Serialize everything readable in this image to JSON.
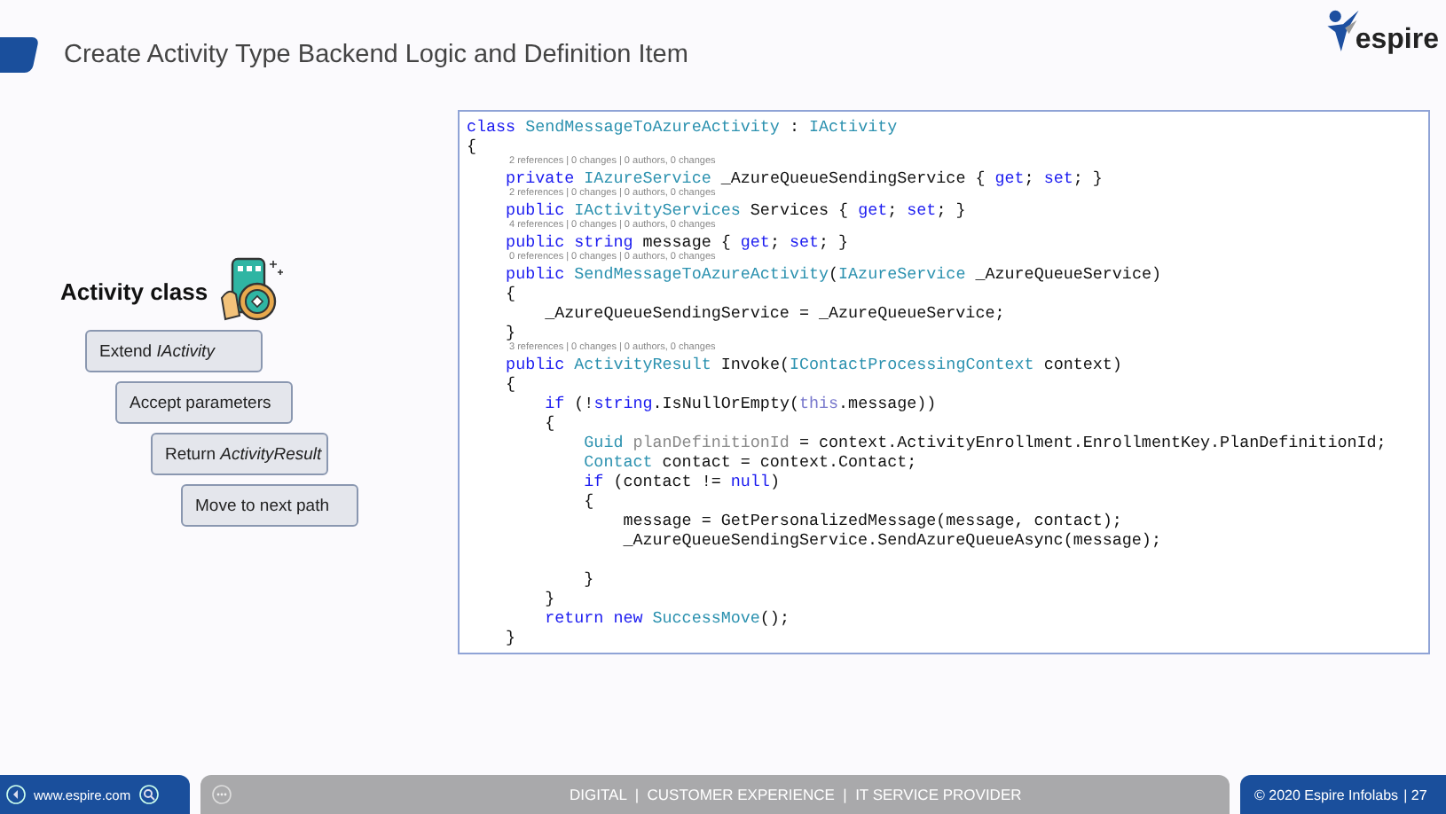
{
  "slide": {
    "title": "Create Activity Type Backend Logic and Definition Item",
    "logo_text": "espire",
    "activity_heading": "Activity class",
    "steps": [
      "Extend *IActivity*",
      "Accept parameters",
      "Return *ActivityResult*",
      "Move to next path"
    ],
    "code_lines": [
      {
        "kind": "code",
        "tokens": [
          {
            "kind": "kw",
            "text": "class "
          },
          {
            "kind": "type",
            "text": "SendMessageToAzureActivity"
          },
          {
            "kind": "plain",
            "text": " : "
          },
          {
            "kind": "type",
            "text": "IActivity"
          }
        ]
      },
      {
        "kind": "code",
        "tokens": [
          {
            "kind": "plain",
            "text": "{"
          }
        ]
      },
      {
        "kind": "lens",
        "tokens": [
          {
            "kind": "plain",
            "text": "2 references | 0 changes | 0 authors, 0 changes"
          }
        ]
      },
      {
        "kind": "code",
        "tokens": [
          {
            "kind": "kw",
            "text": "    private "
          },
          {
            "kind": "type",
            "text": "IAzureService"
          },
          {
            "kind": "plain",
            "text": " _AzureQueueSendingService { "
          },
          {
            "kind": "kw",
            "text": "get"
          },
          {
            "kind": "plain",
            "text": "; "
          },
          {
            "kind": "kw",
            "text": "set"
          },
          {
            "kind": "plain",
            "text": "; }"
          }
        ]
      },
      {
        "kind": "lens",
        "tokens": [
          {
            "kind": "plain",
            "text": "2 references | 0 changes | 0 authors, 0 changes"
          }
        ]
      },
      {
        "kind": "code",
        "tokens": [
          {
            "kind": "kw",
            "text": "    public "
          },
          {
            "kind": "type",
            "text": "IActivityServices"
          },
          {
            "kind": "plain",
            "text": " Services { "
          },
          {
            "kind": "kw",
            "text": "get"
          },
          {
            "kind": "plain",
            "text": "; "
          },
          {
            "kind": "kw",
            "text": "set"
          },
          {
            "kind": "plain",
            "text": "; }"
          }
        ]
      },
      {
        "kind": "lens",
        "tokens": [
          {
            "kind": "plain",
            "text": "4 references | 0 changes | 0 authors, 0 changes"
          }
        ]
      },
      {
        "kind": "code",
        "tokens": [
          {
            "kind": "kw",
            "text": "    public string "
          },
          {
            "kind": "plain",
            "text": "message { "
          },
          {
            "kind": "kw",
            "text": "get"
          },
          {
            "kind": "plain",
            "text": "; "
          },
          {
            "kind": "kw",
            "text": "set"
          },
          {
            "kind": "plain",
            "text": "; }"
          }
        ]
      },
      {
        "kind": "lens",
        "tokens": [
          {
            "kind": "plain",
            "text": "0 references | 0 changes | 0 authors, 0 changes"
          }
        ]
      },
      {
        "kind": "code",
        "tokens": [
          {
            "kind": "kw",
            "text": "    public "
          },
          {
            "kind": "type",
            "text": "SendMessageToAzureActivity"
          },
          {
            "kind": "plain",
            "text": "("
          },
          {
            "kind": "type",
            "text": "IAzureService"
          },
          {
            "kind": "plain",
            "text": " _AzureQueueService)"
          }
        ]
      },
      {
        "kind": "code",
        "tokens": [
          {
            "kind": "plain",
            "text": "    {"
          }
        ]
      },
      {
        "kind": "code",
        "tokens": [
          {
            "kind": "plain",
            "text": "        _AzureQueueSendingService = _AzureQueueService;"
          }
        ]
      },
      {
        "kind": "code",
        "tokens": [
          {
            "kind": "plain",
            "text": "    }"
          }
        ]
      },
      {
        "kind": "lens",
        "tokens": [
          {
            "kind": "plain",
            "text": "3 references | 0 changes | 0 authors, 0 changes"
          }
        ]
      },
      {
        "kind": "code",
        "tokens": [
          {
            "kind": "kw",
            "text": "    public "
          },
          {
            "kind": "type",
            "text": "ActivityResult"
          },
          {
            "kind": "plain",
            "text": " Invoke("
          },
          {
            "kind": "type",
            "text": "IContactProcessingContext"
          },
          {
            "kind": "plain",
            "text": " context)"
          }
        ]
      },
      {
        "kind": "code",
        "tokens": [
          {
            "kind": "plain",
            "text": "    {"
          }
        ]
      },
      {
        "kind": "code",
        "tokens": [
          {
            "kind": "kw",
            "text": "        if"
          },
          {
            "kind": "plain",
            "text": " (!"
          },
          {
            "kind": "kw",
            "text": "string"
          },
          {
            "kind": "plain",
            "text": ".IsNullOrEmpty("
          },
          {
            "kind": "this",
            "text": "this"
          },
          {
            "kind": "plain",
            "text": ".message))"
          }
        ]
      },
      {
        "kind": "code",
        "tokens": [
          {
            "kind": "plain",
            "text": "        {"
          }
        ]
      },
      {
        "kind": "code",
        "tokens": [
          {
            "kind": "type",
            "text": "            Guid"
          },
          {
            "kind": "dim",
            "text": " planDefinitionId"
          },
          {
            "kind": "plain",
            "text": " = context.ActivityEnrollment.EnrollmentKey.PlanDefinitionId;"
          }
        ]
      },
      {
        "kind": "code",
        "tokens": [
          {
            "kind": "type",
            "text": "            Contact"
          },
          {
            "kind": "plain",
            "text": " contact = context.Contact;"
          }
        ]
      },
      {
        "kind": "code",
        "tokens": [
          {
            "kind": "kw",
            "text": "            if"
          },
          {
            "kind": "plain",
            "text": " (contact != "
          },
          {
            "kind": "kw",
            "text": "null"
          },
          {
            "kind": "plain",
            "text": ")"
          }
        ]
      },
      {
        "kind": "code",
        "tokens": [
          {
            "kind": "plain",
            "text": "            {"
          }
        ]
      },
      {
        "kind": "code",
        "tokens": [
          {
            "kind": "plain",
            "text": "                message = GetPersonalizedMessage(message, contact);"
          }
        ]
      },
      {
        "kind": "code",
        "tokens": [
          {
            "kind": "plain",
            "text": "                _AzureQueueSendingService.SendAzureQueueAsync(message);"
          }
        ]
      },
      {
        "kind": "blank"
      },
      {
        "kind": "code",
        "tokens": [
          {
            "kind": "plain",
            "text": "            }"
          }
        ]
      },
      {
        "kind": "code",
        "tokens": [
          {
            "kind": "plain",
            "text": "        }"
          }
        ]
      },
      {
        "kind": "code",
        "tokens": [
          {
            "kind": "kw",
            "text": "        return new "
          },
          {
            "kind": "type",
            "text": "SuccessMove"
          },
          {
            "kind": "plain",
            "text": "();"
          }
        ]
      },
      {
        "kind": "code",
        "tokens": [
          {
            "kind": "plain",
            "text": "    }"
          }
        ]
      }
    ]
  },
  "footer": {
    "website": "www.espire.com",
    "tagline": "DIGITAL  |  CUSTOMER EXPERIENCE  |  IT SERVICE PROVIDER",
    "copyright": "© 2020 Espire Infolabs",
    "page": "| 27"
  }
}
